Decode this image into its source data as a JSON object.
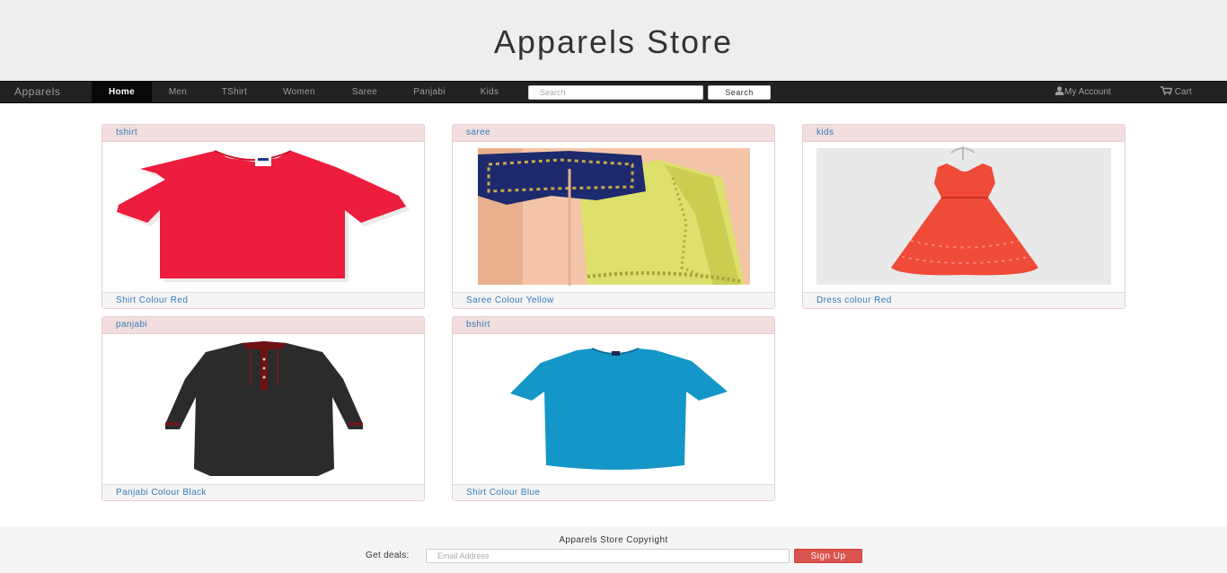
{
  "header": {
    "title": "Apparels Store"
  },
  "navbar": {
    "brand": "Apparels",
    "items": [
      {
        "label": "Home",
        "active": true
      },
      {
        "label": "Men"
      },
      {
        "label": "TShirt"
      },
      {
        "label": "Women"
      },
      {
        "label": "Saree"
      },
      {
        "label": "Panjabi"
      },
      {
        "label": "Kids"
      }
    ],
    "search": {
      "placeholder": "Search",
      "button_label": "Search"
    },
    "account": {
      "label": "My Account",
      "icon": "user-icon"
    },
    "cart": {
      "label": "Cart",
      "icon": "cart-icon"
    }
  },
  "products": [
    {
      "category": "tshirt",
      "title": "Shirt Colour Red",
      "color": "#ee1c3d"
    },
    {
      "category": "saree",
      "title": "Saree Colour Yellow",
      "color": "#dde06a"
    },
    {
      "category": "kids",
      "title": "Dress colour Red",
      "color": "#f04a38"
    },
    {
      "category": "panjabi",
      "title": "Panjabi Colour Black",
      "color": "#2b2b2b"
    },
    {
      "category": "bshirt",
      "title": "Shirt Colour Blue",
      "color": "#1596c8"
    }
  ],
  "footer": {
    "copyright": "Apparels Store Copyright",
    "deals_label": "Get deals:",
    "email_placeholder": "Email Address",
    "signup_label": "Sign Up"
  },
  "colors": {
    "navbar_bg": "#222222",
    "panel_heading_bg": "#f2dede",
    "link": "#337ab7",
    "signup_button": "#d9534f"
  }
}
